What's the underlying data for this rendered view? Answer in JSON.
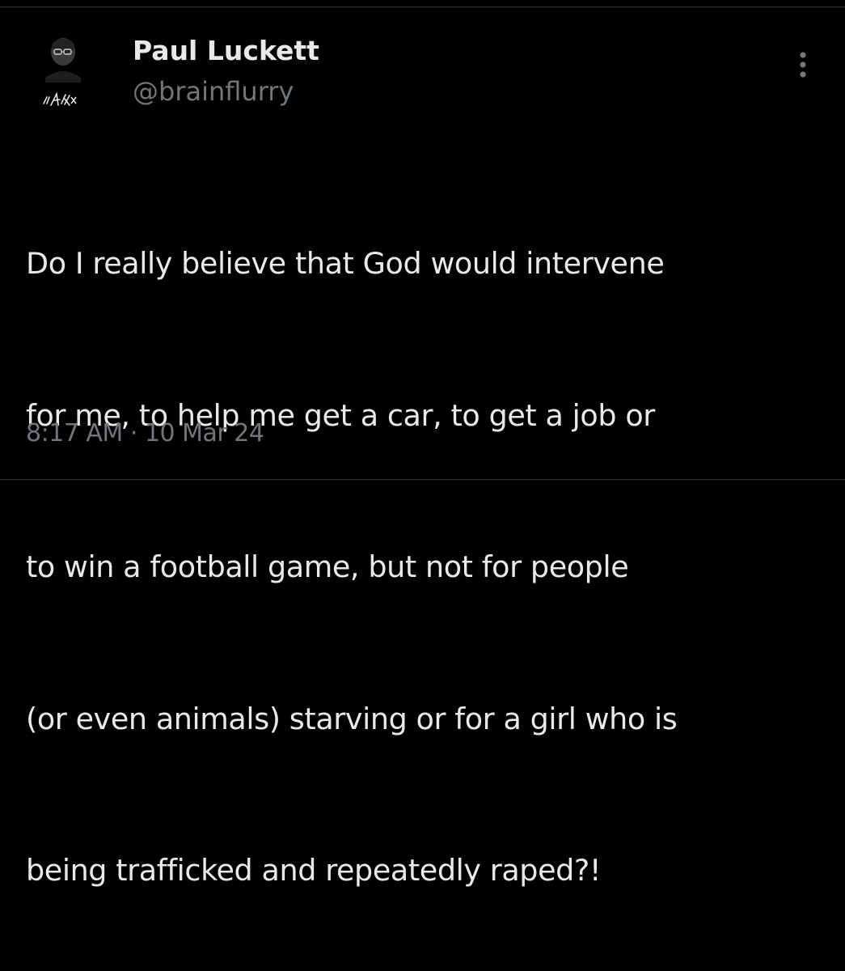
{
  "author": {
    "display_name": "Paul Luckett",
    "handle": "@brainflurry",
    "avatar_icon": "profile-photo"
  },
  "tweet": {
    "text_lines": [
      "Do I really believe that God would intervene",
      "for me, to help me get a car, to get a job or",
      "to win a football game, but not for people",
      "(or even animals) starving or for a girl who is",
      "being trafficked and repeatedly raped?!"
    ],
    "time": "8:17 AM",
    "separator": "·",
    "date": "10 Mar 24"
  },
  "menu": {
    "icon": "more-options-icon"
  },
  "colors": {
    "background": "#000000",
    "primary_text": "#e7e9ea",
    "secondary_text": "#71767b",
    "divider": "#2f3336"
  }
}
